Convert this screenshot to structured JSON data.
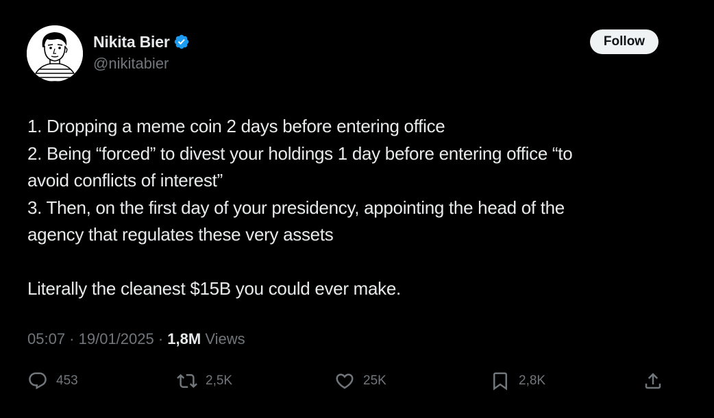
{
  "author": {
    "display_name": "Nikita Bier",
    "handle": "@nikitabier",
    "verified": true,
    "verified_color": "#1d9bf0"
  },
  "follow_label": "Follow",
  "tweet": {
    "lines": [
      "1. Dropping a meme coin 2 days before entering office",
      "2. Being “forced” to divest your holdings 1 day before entering office “to",
      "avoid conflicts of interest”",
      "3. Then, on the first day of your presidency, appointing the head of the",
      "agency that regulates these very assets",
      "",
      "Literally the cleanest $15B you could ever make."
    ]
  },
  "meta": {
    "time": "05:07",
    "separator": " · ",
    "date": "19/01/2025",
    "views_count": "1,8M",
    "views_label": " Views"
  },
  "actions": {
    "replies": {
      "icon": "reply-icon",
      "count": "453"
    },
    "reposts": {
      "icon": "repost-icon",
      "count": "2,5K"
    },
    "likes": {
      "icon": "like-icon",
      "count": "25K"
    },
    "bookmarks": {
      "icon": "bookmark-icon",
      "count": "2,8K"
    },
    "share": {
      "icon": "share-icon"
    }
  },
  "colors": {
    "background": "#000000",
    "text_primary": "#e7e9ea",
    "text_secondary": "#71767b",
    "follow_bg": "#eff3f4"
  }
}
